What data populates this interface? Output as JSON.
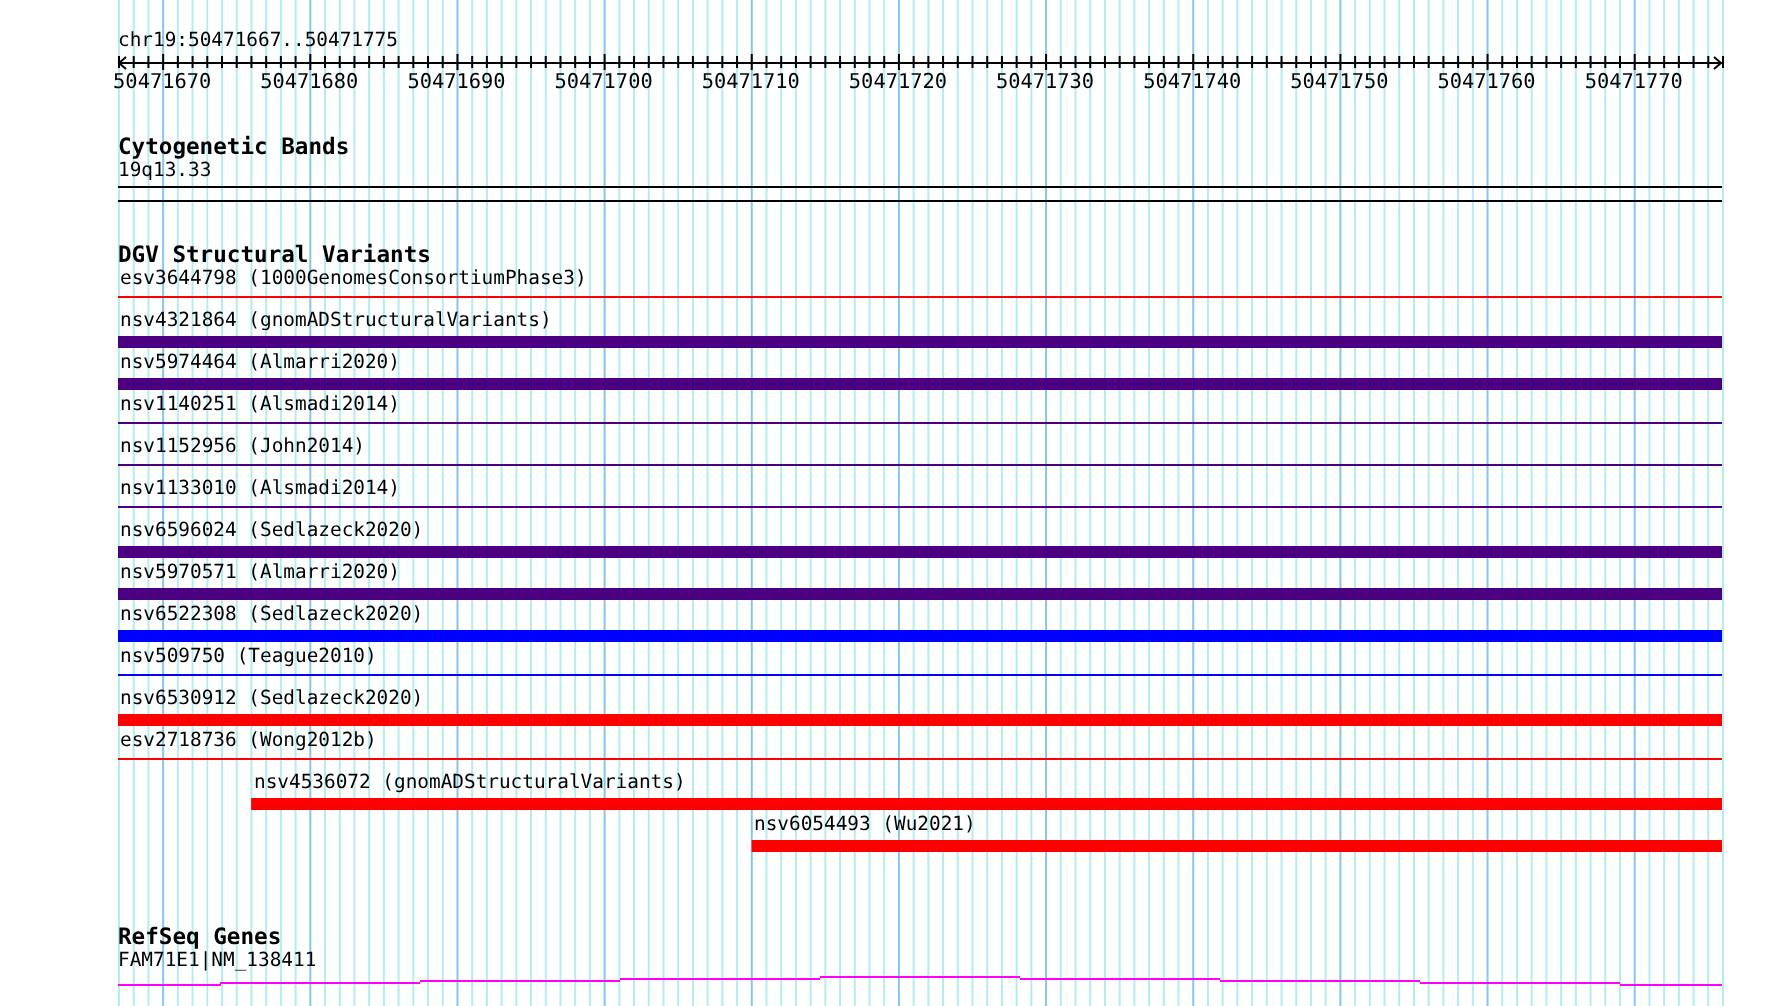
{
  "ruler": {
    "location": "chr19:50471667..50471775",
    "ticks": [
      "50471670",
      "50471680",
      "50471690",
      "50471700",
      "50471710",
      "50471720",
      "50471730",
      "50471740",
      "50471750",
      "50471760",
      "50471770"
    ]
  },
  "cytogenetic_bands": {
    "title": "Cytogenetic Bands",
    "band": "19q13.33"
  },
  "dgv": {
    "title": "DGV Structural Variants",
    "features": [
      {
        "label": "esv3644798 (1000GenomesConsortiumPhase3)",
        "kind": "thin",
        "color": "#ff0000"
      },
      {
        "label": "nsv4321864 (gnomADStructuralVariants)",
        "kind": "thick",
        "color": "#4b0082"
      },
      {
        "label": "nsv5974464 (Almarri2020)",
        "kind": "thick",
        "color": "#4b0082"
      },
      {
        "label": "nsv1140251 (Alsmadi2014)",
        "kind": "thin",
        "color": "#4b0082"
      },
      {
        "label": "nsv1152956 (John2014)",
        "kind": "thin",
        "color": "#4b0082"
      },
      {
        "label": "nsv1133010 (Alsmadi2014)",
        "kind": "thin",
        "color": "#4b0082"
      },
      {
        "label": "nsv6596024 (Sedlazeck2020)",
        "kind": "thick",
        "color": "#4b0082"
      },
      {
        "label": "nsv5970571 (Almarri2020)",
        "kind": "thick",
        "color": "#4b0082"
      },
      {
        "label": "nsv6522308 (Sedlazeck2020)",
        "kind": "thick",
        "color": "#0000ff"
      },
      {
        "label": "nsv509750 (Teague2010)",
        "kind": "thin",
        "color": "#0000ff"
      },
      {
        "label": "nsv6530912 (Sedlazeck2020)",
        "kind": "thick",
        "color": "#ff0000"
      },
      {
        "label": "esv2718736 (Wong2012b)",
        "kind": "thin",
        "color": "#ff0000"
      },
      {
        "label": "nsv4536072 (gnomADStructuralVariants)",
        "kind": "thick",
        "color": "#ff0000",
        "level": 0.917
      },
      {
        "label": "nsv6054493 (Wu2021)",
        "kind": "thick",
        "color": "#ff0000",
        "level": 0.605
      }
    ]
  },
  "refseq": {
    "title": "RefSeq Genes",
    "gene": "FAM71E1|NM_138411"
  }
}
